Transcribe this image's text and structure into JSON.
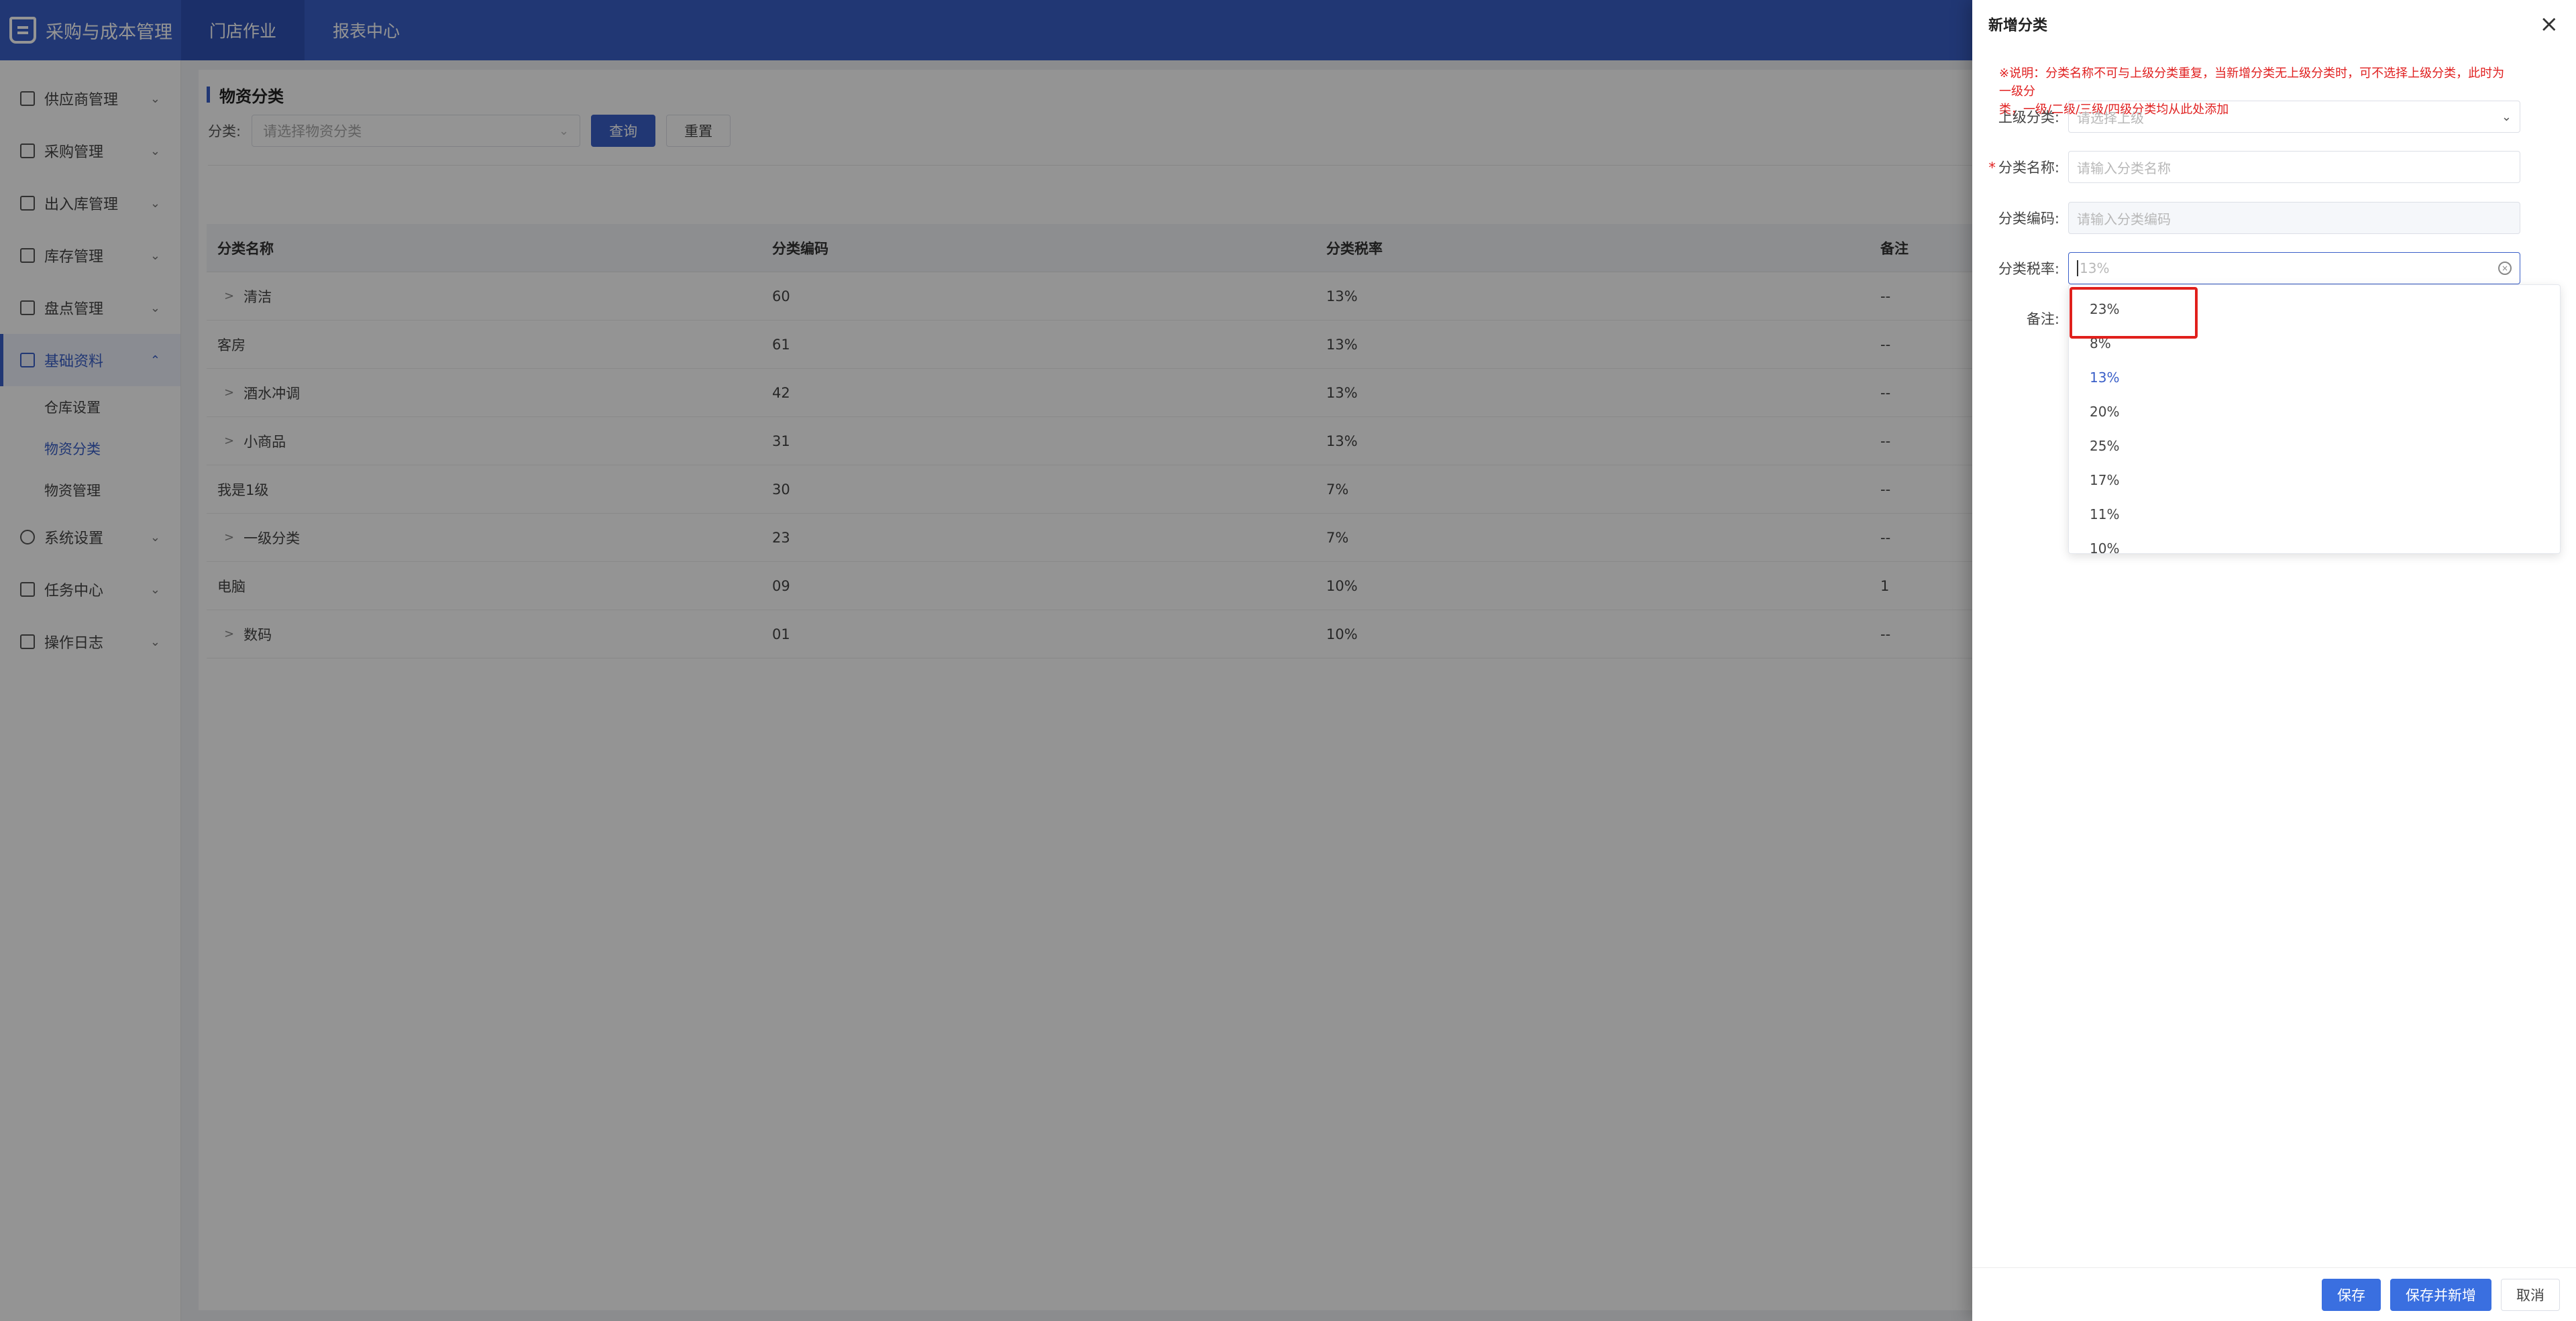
{
  "app": {
    "title": "采购与成本管理"
  },
  "topnav": [
    {
      "label": "门店作业",
      "active": true
    },
    {
      "label": "报表中心",
      "active": false
    }
  ],
  "sidebar": {
    "items": [
      {
        "label": "供应商管理",
        "icon": "supplier-icon"
      },
      {
        "label": "采购管理",
        "icon": "purchase-icon"
      },
      {
        "label": "出入库管理",
        "icon": "inout-icon"
      },
      {
        "label": "库存管理",
        "icon": "inventory-icon"
      },
      {
        "label": "盘点管理",
        "icon": "stocktake-icon"
      },
      {
        "label": "基础资料",
        "icon": "basic-data-icon",
        "open": true,
        "children": [
          {
            "label": "仓库设置"
          },
          {
            "label": "物资分类",
            "active": true
          },
          {
            "label": "物资管理"
          }
        ]
      },
      {
        "label": "系统设置",
        "icon": "settings-icon"
      },
      {
        "label": "任务中心",
        "icon": "task-icon"
      },
      {
        "label": "操作日志",
        "icon": "log-icon"
      }
    ]
  },
  "main": {
    "page_title": "物资分类",
    "filter": {
      "label": "分类:",
      "placeholder": "请选择物资分类",
      "query_label": "查询",
      "reset_label": "重置"
    },
    "table": {
      "columns": [
        "分类名称",
        "分类编码",
        "分类税率",
        "备注"
      ],
      "rows": [
        {
          "name": "清洁",
          "code": "60",
          "rate": "13%",
          "note": "--",
          "expandable": true
        },
        {
          "name": "客房",
          "code": "61",
          "rate": "13%",
          "note": "--",
          "expandable": false
        },
        {
          "name": "酒水冲调",
          "code": "42",
          "rate": "13%",
          "note": "--",
          "expandable": true
        },
        {
          "name": "小商品",
          "code": "31",
          "rate": "13%",
          "note": "--",
          "expandable": true
        },
        {
          "name": "我是1级",
          "code": "30",
          "rate": "7%",
          "note": "--",
          "expandable": false
        },
        {
          "name": "一级分类",
          "code": "23",
          "rate": "7%",
          "note": "--",
          "expandable": true
        },
        {
          "name": "电脑",
          "code": "09",
          "rate": "10%",
          "note": "1",
          "expandable": false
        },
        {
          "name": "数码",
          "code": "01",
          "rate": "10%",
          "note": "--",
          "expandable": true
        }
      ]
    }
  },
  "drawer": {
    "title": "新增分类",
    "notice_line1": "※说明：分类名称不可与上级分类重复，当新增分类无上级分类时，可不选择上级分类，此时为一级分",
    "notice_line2": "类，一级/二级/三级/四级分类均从此处添加",
    "fields": {
      "parent": {
        "label": "上级分类:",
        "placeholder": "请选择上级"
      },
      "name": {
        "label": "分类名称:",
        "placeholder": "请输入分类名称",
        "required": true
      },
      "code": {
        "label": "分类编码:",
        "placeholder": "请输入分类编码"
      },
      "rate": {
        "label": "分类税率:",
        "placeholder": "13%"
      },
      "note": {
        "label": "备注:"
      }
    },
    "rate_options": [
      "23%",
      "8%",
      "13%",
      "20%",
      "25%",
      "17%",
      "11%",
      "10%"
    ],
    "rate_selected": "13%",
    "buttons": {
      "save": "保存",
      "save_new": "保存并新增",
      "cancel": "取消"
    }
  },
  "colors": {
    "primary": "#3a5fc8",
    "danger": "#e02020",
    "highlight": "#e0201c"
  }
}
